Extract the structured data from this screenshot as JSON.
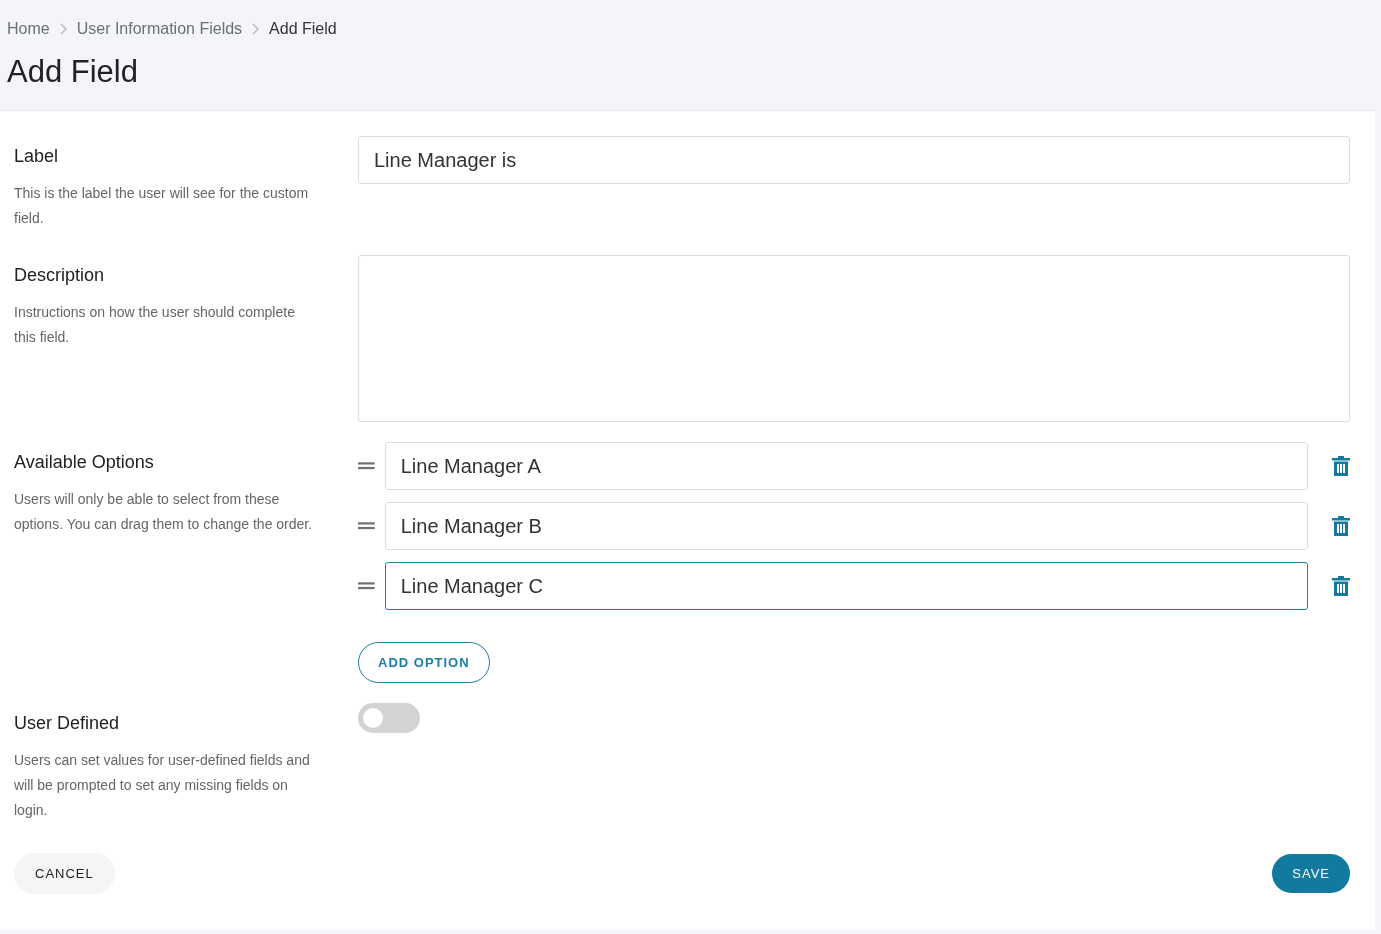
{
  "breadcrumb": [
    {
      "label": "Home",
      "current": false
    },
    {
      "label": "User Information Fields",
      "current": false
    },
    {
      "label": "Add Field",
      "current": true
    }
  ],
  "title": "Add Field",
  "label_section": {
    "title": "Label",
    "help": "This is the label the user will see for the custom field.",
    "value": "Line Manager is"
  },
  "description_section": {
    "title": "Description",
    "help": "Instructions on how the user should complete this field."
  },
  "options_section": {
    "title": "Available Options",
    "help": "Users will only be able to select from these options. You can drag them to change the order.",
    "options": [
      {
        "value": "Line Manager A",
        "focused": false
      },
      {
        "value": "Line Manager B",
        "focused": false
      },
      {
        "value": "Line Manager C",
        "focused": true
      }
    ],
    "add_button": "ADD OPTION"
  },
  "user_defined_section": {
    "title": "User Defined",
    "help": "Users can set values for user-defined fields and will be prompted to set any missing fields on login.",
    "on": false
  },
  "buttons": {
    "cancel": "CANCEL",
    "save": "SAVE"
  }
}
